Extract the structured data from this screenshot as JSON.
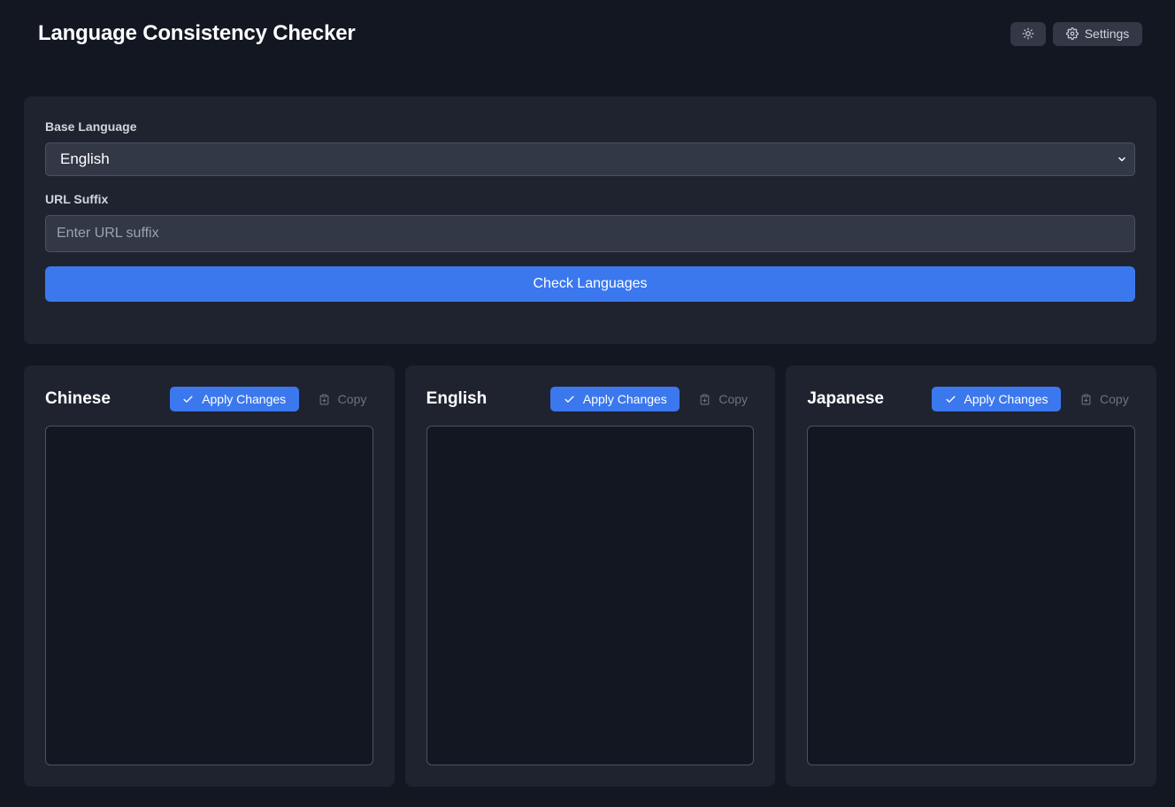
{
  "app": {
    "title": "Language Consistency Checker"
  },
  "header": {
    "theme_icon": "sun-icon",
    "settings_icon": "gear-icon",
    "settings_label": "Settings"
  },
  "form": {
    "base_language_label": "Base Language",
    "base_language_value": "English",
    "url_suffix_label": "URL Suffix",
    "url_suffix_placeholder": "Enter URL suffix",
    "url_suffix_value": "",
    "check_button_label": "Check Languages"
  },
  "columns": [
    {
      "title": "Chinese",
      "apply_label": "Apply Changes",
      "copy_label": "Copy",
      "content": ""
    },
    {
      "title": "English",
      "apply_label": "Apply Changes",
      "copy_label": "Copy",
      "content": ""
    },
    {
      "title": "Japanese",
      "apply_label": "Apply Changes",
      "copy_label": "Copy",
      "content": ""
    }
  ],
  "colors": {
    "background": "#131722",
    "card": "#1f2330",
    "accent": "#3b78ed",
    "input": "#323846"
  }
}
